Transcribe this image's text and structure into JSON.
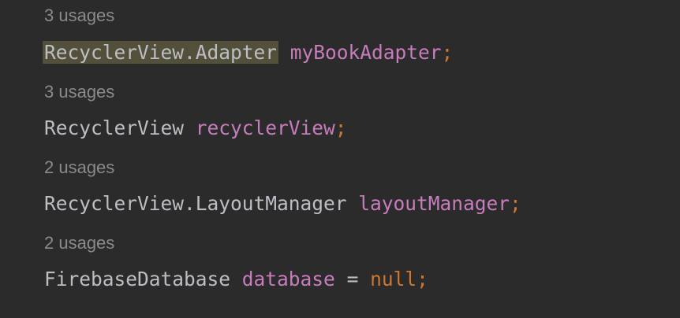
{
  "colors": {
    "background": "#2b2b2b",
    "hint": "#8a8a8a",
    "type": "#bcbec4",
    "field": "#c77dbb",
    "punctuation": "#cc7832",
    "highlight": "#52503a"
  },
  "lines": [
    {
      "usages": "3 usages",
      "type": "RecyclerView.Adapter",
      "name": "myBookAdapter",
      "end": ";"
    },
    {
      "usages": "3 usages",
      "type": "RecyclerView",
      "name": "recyclerView",
      "end": ";"
    },
    {
      "usages": "2 usages",
      "type": "RecyclerView.LayoutManager",
      "name": "layoutManager",
      "end": ";"
    },
    {
      "usages": "2 usages",
      "type": "FirebaseDatabase",
      "name": "database",
      "assign": "=",
      "value": "null",
      "end": ";"
    }
  ]
}
